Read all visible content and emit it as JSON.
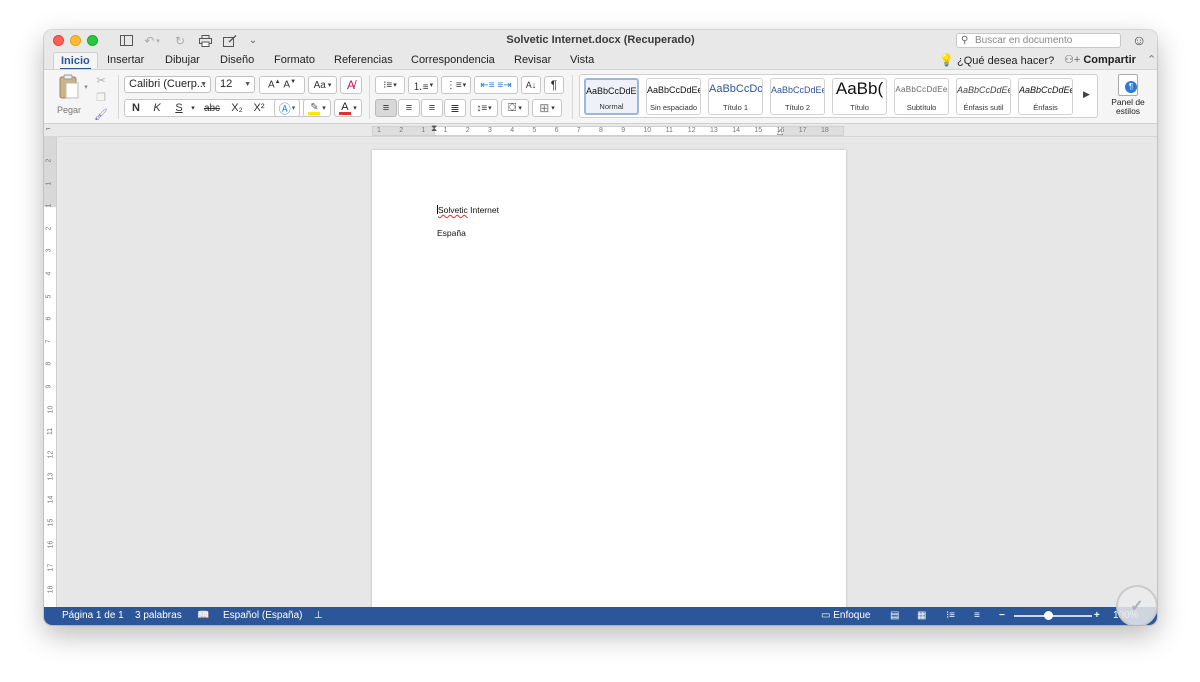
{
  "window": {
    "title": "Solvetic Internet.docx (Recuperado)",
    "search_placeholder": "Buscar en documento"
  },
  "tabs": [
    {
      "label": "Inicio",
      "active": true
    },
    {
      "label": "Insertar"
    },
    {
      "label": "Dibujar"
    },
    {
      "label": "Diseño"
    },
    {
      "label": "Formato"
    },
    {
      "label": "Referencias"
    },
    {
      "label": "Correspondencia"
    },
    {
      "label": "Revisar"
    },
    {
      "label": "Vista"
    }
  ],
  "tell_me": "¿Qué desea hacer?",
  "share_label": "Compartir",
  "ribbon": {
    "paste_label": "Pegar",
    "font_name": "Calibri (Cuerp...",
    "font_size": "12",
    "bold": "N",
    "italic": "K",
    "underline": "S",
    "strike": "abc",
    "subscript": "X₂",
    "superscript": "X²",
    "styles_panel": "Panel de estilos",
    "styles": [
      {
        "name": "Normal",
        "sample": "AaBbCcDdEe",
        "selected": true
      },
      {
        "name": "Sin espaciado",
        "sample": "AaBbCcDdEe"
      },
      {
        "name": "Título 1",
        "sample": "AaBbCcDc"
      },
      {
        "name": "Título 2",
        "sample": "AaBbCcDdEe"
      },
      {
        "name": "Título",
        "sample": "AaBb("
      },
      {
        "name": "Subtítulo",
        "sample": "AaBbCcDdEe"
      },
      {
        "name": "Énfasis sutil",
        "sample": "AaBbCcDdEe"
      },
      {
        "name": "Énfasis",
        "sample": "AaBbCcDdEe"
      }
    ]
  },
  "ruler_numbers": [
    "1",
    "2",
    "1",
    "1",
    "2",
    "3",
    "4",
    "5",
    "6",
    "7",
    "8",
    "9",
    "10",
    "11",
    "12",
    "13",
    "14",
    "15",
    "16",
    "17",
    "18"
  ],
  "vruler_numbers": [
    "2",
    "1",
    "1",
    "2",
    "3",
    "4",
    "5",
    "6",
    "7",
    "8",
    "9",
    "10",
    "11",
    "12",
    "13",
    "14",
    "15",
    "16",
    "17",
    "18"
  ],
  "document": {
    "paragraphs": [
      "Solvetic Internet",
      "España"
    ]
  },
  "status": {
    "page": "Página 1 de 1",
    "words": "3 palabras",
    "language": "Español (España)",
    "focus": "Enfoque",
    "zoom": "100%"
  },
  "colors": {
    "accent": "#2b579a",
    "highlight": "#ffe600",
    "font_color": "#e0322b"
  }
}
